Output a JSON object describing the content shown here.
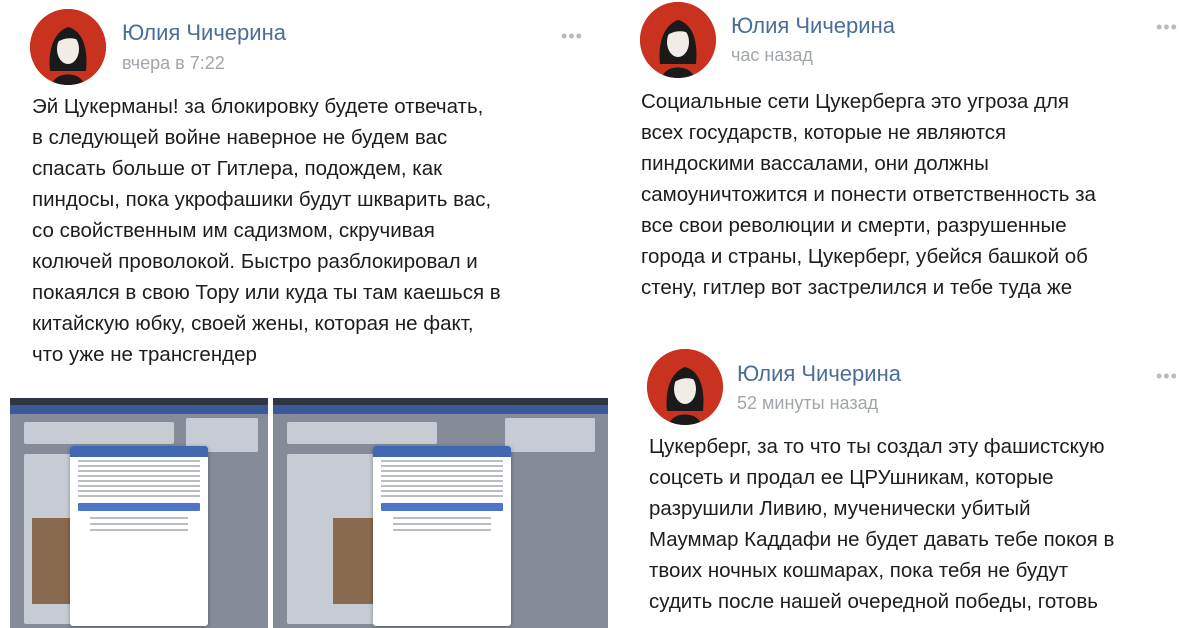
{
  "left_post": {
    "author": "Юлия Чичерина",
    "time": "вчера в 7:22",
    "more_icon": "•••",
    "text": "Эй Цукерманы! за блокировку будете отвечать,\nв следующей войне наверное не будем вас\nспасать больше от Гитлера, подождем, как\nпиндосы, пока укрофашики будут шкварить вас,\nсо свойственным им садизмом, скручивая\nколючей проволокой. Быстро разблокировал и\nпокаялся в свою Тору или куда ты там каешься в\nкитайскую юбку, своей жены, которая не факт,\nчто уже не трансгендер"
  },
  "right_post_1": {
    "author": "Юлия Чичерина",
    "time": "час назад",
    "more_icon": "•••",
    "text": "Социальные сети Цукерберга это угроза для\nвсех государств, которые не являются\nпиндоскими вассалами, они должны\nсамоуничтожится и понести ответственность за\nвсе свои революции и смерти, разрушенные\nгорода и страны, Цукерберг, убейся башкой об\nстену, гитлер вот застрелился  и тебе туда же"
  },
  "right_post_2": {
    "author": "Юлия Чичерина",
    "time": "52 минуты назад",
    "more_icon": "•••",
    "text": "Цукерберг, за то что ты создал эту фашистскую\nсоцсеть и продал ее ЦРУшникам, которые\nразрушили Ливию, мученически убитый\nМауммар Каддафи не будет давать тебе покоя в\nтвоих ночных кошмарах, пока тебя не будут\nсудить после нашей очередной победы, готовь"
  },
  "colors": {
    "author": "#4a6e97",
    "time": "#a0a5ac",
    "avatar_bg": "#c8321f",
    "facebook_blue": "#3b5998"
  },
  "icons": {
    "avatar": "portrait-avatar-icon",
    "more": "more-dots-icon"
  }
}
